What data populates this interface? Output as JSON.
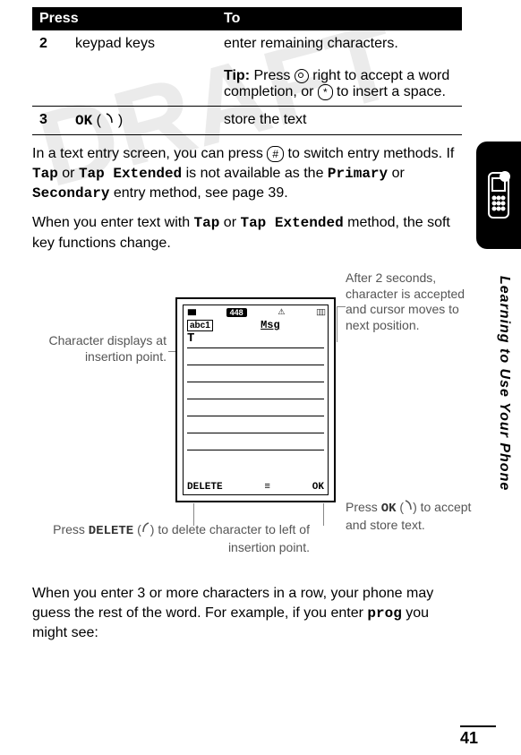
{
  "table": {
    "headers": [
      "Press",
      "To"
    ],
    "rows": [
      {
        "num": "2",
        "press": "keypad keys",
        "to_main": "enter remaining characters.",
        "tip_label": "Tip:",
        "tip_text": " Press ",
        "tip_text2": " right to accept a word completion, or ",
        "tip_text3": " to insert a space."
      },
      {
        "num": "3",
        "press": "OK",
        "press_suffix": "(",
        "press_suffix2": ")",
        "to_main": "store the text"
      }
    ]
  },
  "para1_a": "In a text entry screen, you can press ",
  "para1_b": " to switch entry methods. If ",
  "para1_tap": "Tap",
  "para1_or": " or ",
  "para1_tapext": "Tap Extended",
  "para1_c": " is not available as the ",
  "para1_primary": "Primary",
  "para1_or2": " or ",
  "para1_secondary": "Secondary",
  "para1_d": " entry method, see page 39.",
  "para2_a": "When you enter text with ",
  "para2_b": " method, the soft key functions change.",
  "screen": {
    "status_448": "448",
    "abc": "abc1",
    "msg": "Msg",
    "first_char": "T",
    "delete": "DELETE",
    "ok": "OK"
  },
  "callouts": {
    "left1": "Character displays at insertion point.",
    "right1": "After 2 seconds, character is accepted and cursor moves to next position.",
    "left2_a": "Press ",
    "left2_delete": "DELETE",
    "left2_b": " (",
    "left2_c": ") to delete character to left of insertion point.",
    "right2_a": "Press ",
    "right2_ok": "OK",
    "right2_b": " (",
    "right2_c": ") to accept and store text."
  },
  "para3_a": "When you enter 3 or more characters in a row, your phone may guess the rest of the word. For example, if you enter ",
  "para3_prog": "prog",
  "para3_b": " you might see:",
  "side_label": "Learning to Use Your Phone",
  "page_number": "41",
  "star_key": "*",
  "hash_key": "#"
}
